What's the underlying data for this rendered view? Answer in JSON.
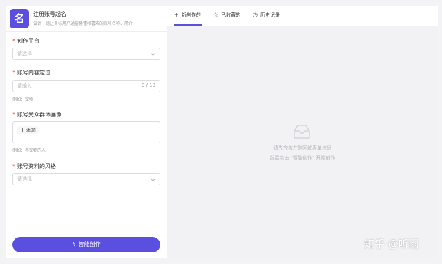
{
  "app": {
    "icon_char": "名",
    "title": "注册账号起名",
    "subtitle": "设计一组让目标用户通俗易懂和喜欢的账号名称、简介"
  },
  "form": {
    "platform": {
      "label": "创作平台",
      "placeholder": "请选择"
    },
    "positioning": {
      "label": "账号内容定位",
      "placeholder": "请输入",
      "count": "0 / 10",
      "hint": "例如：宠物"
    },
    "audience": {
      "label": "账号受众群体画像",
      "add_label": "添加",
      "hint": "例如：养宠物的人"
    },
    "style": {
      "label": "账号资料的风格",
      "placeholder": "请选择"
    },
    "required_mark": "*"
  },
  "submit": {
    "label": "智能创作"
  },
  "tabs": [
    {
      "label": "新创作的",
      "icon": "plus-icon",
      "active": true
    },
    {
      "label": "已收藏的",
      "icon": "star-icon",
      "active": false
    },
    {
      "label": "历史记录",
      "icon": "clock-icon",
      "active": false
    }
  ],
  "empty_state": {
    "line1": "请先完善左侧区域表单信息",
    "line2": "然后点击 \"智能创作\" 开始创作",
    "icon": "inbox-icon"
  },
  "watermark": "知乎 @听雨",
  "colors": {
    "accent": "#5b4fe0",
    "required": "#e8493d",
    "background": "#f3f3f5"
  }
}
